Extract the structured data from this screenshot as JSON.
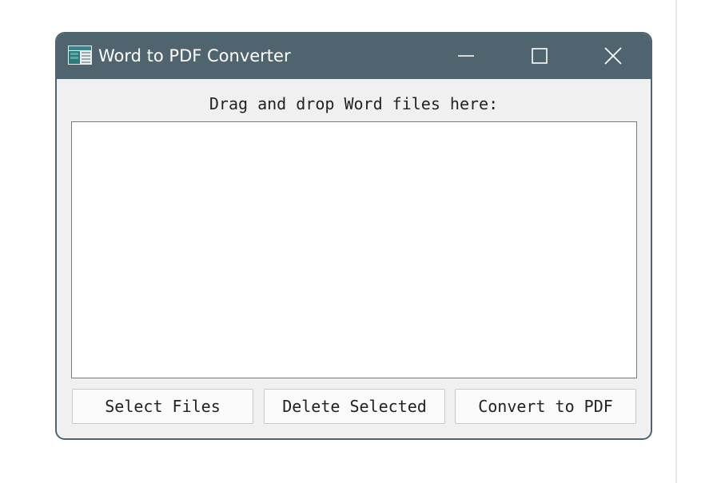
{
  "window": {
    "title": "Word to PDF Converter",
    "titlebar_color": "#4f646e",
    "controls": {
      "minimize_icon": "minimize-icon",
      "maximize_icon": "maximize-icon",
      "close_icon": "close-icon"
    }
  },
  "main": {
    "drop_label": "Drag and drop Word files here:",
    "file_list": []
  },
  "buttons": {
    "select_files": "Select Files",
    "delete_selected": "Delete Selected",
    "convert_to_pdf": "Convert to PDF"
  }
}
